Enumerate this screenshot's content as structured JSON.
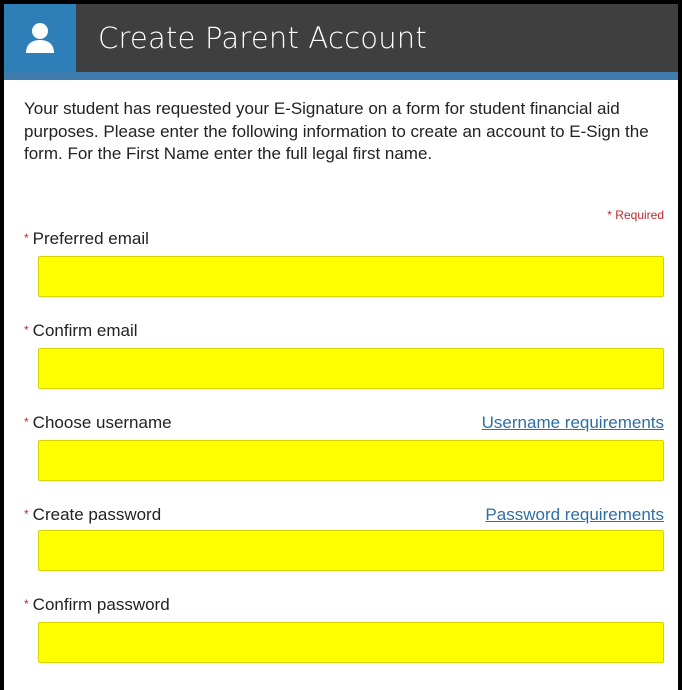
{
  "header": {
    "title": "Create Parent Account",
    "icon": "user-icon"
  },
  "intro_text": "Your student has requested your E-Signature on a form for student financial aid purposes.  Please enter the following information to create an account to E-Sign the form.  For the First Name enter the full legal first name.",
  "required_note": "* Required",
  "required_marker": "*",
  "fields": [
    {
      "label": "Preferred email",
      "value": "",
      "placeholder": ""
    },
    {
      "label": "Confirm email",
      "value": "",
      "placeholder": ""
    },
    {
      "label": "Choose username",
      "value": "",
      "placeholder": "",
      "link": "Username requirements"
    },
    {
      "label": "Create password",
      "value": "",
      "placeholder": "",
      "link": "Password requirements"
    },
    {
      "label": "Confirm password",
      "value": "",
      "placeholder": ""
    }
  ],
  "colors": {
    "header_bg": "#3f3f3f",
    "icon_box_bg": "#2e7fb8",
    "input_bg": "#ffff00",
    "required_red": "#c0282d",
    "link_blue": "#2e6fa3"
  }
}
